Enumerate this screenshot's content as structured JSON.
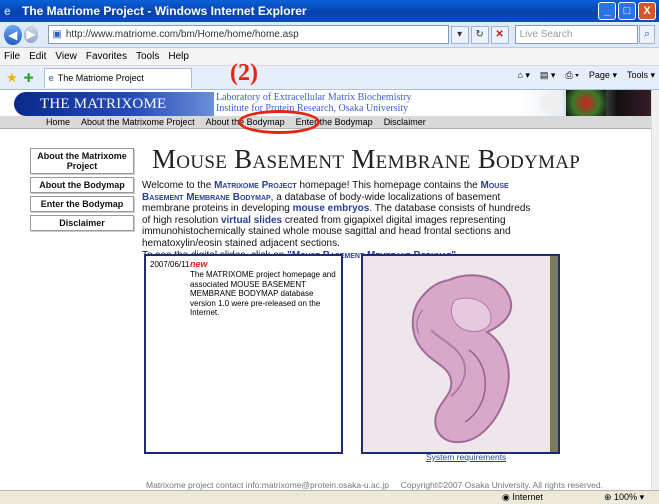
{
  "window": {
    "title": "The Matriome Project - Windows Internet Explorer",
    "buttons": [
      "_",
      "□",
      "X"
    ]
  },
  "address_bar": {
    "url": "http://www.matriome.com/bm/Home/home/home.asp",
    "search_placeholder": "Live Search"
  },
  "menu": [
    "File",
    "Edit",
    "View",
    "Favorites",
    "Tools",
    "Help"
  ],
  "tab": {
    "label": "The Matriome Project",
    "tools": [
      "Page ▾",
      "Tools ▾"
    ]
  },
  "header": {
    "banner": "THE MATRIXOME PROJECT",
    "lab_line1": "Laboratory of Extracellular Matrix Biochemistry",
    "lab_line2": "Institute for Protein Research, Osaka University"
  },
  "topnav": [
    "Home",
    "About the Matrixome Project",
    "About the Bodymap",
    "Enter the Bodymap",
    "Disclaimer"
  ],
  "annotation": {
    "label": "(2)",
    "color": "#e6230f"
  },
  "sidebar": [
    "About the Matrixome Project",
    "About the Bodymap",
    "Enter the Bodymap",
    "Disclaimer"
  ],
  "main": {
    "title": "Mouse Basement Membrane Bodymap",
    "intro": {
      "p1a": "Welcome to the ",
      "brand": "Matrixome Project",
      "p1b": " homepage! This homepage contains the ",
      "bodymap": "Mouse Basement Membrane Bodymap",
      "p1c": ", a database of body-wide localizations of basement membrane proteins in developing ",
      "embryos": "mouse embryos",
      "p1d": ". The database consists of hundreds of high resolution ",
      "slides": "virtual slides",
      "p1e": " created from gigapixel digital images representing immunohistochemically stained whole mouse sagittal and head frontal sections and hematoxylin/eosin stained adjacent sections.",
      "p2a": "To see the digital slides, click on ",
      "link": "\"Mouse Basement Membrane Bodymap\"",
      "p2b": "."
    }
  },
  "news": {
    "date": "2007/06/11",
    "badge": "new",
    "text": "The MATRIXOME project homepage and associated MOUSE BASEMENT MEMBRANE BODYMAP database version 1.0 were pre-released on the Internet."
  },
  "slide": {
    "link": "System requirements"
  },
  "footer": {
    "contact": "Matrixome project contact info:matrixome@protein.osaka-u.ac.jp",
    "copyright": "Copyright©2007 Osaka University. All rights reserved."
  },
  "statusbar": {
    "zone": "Internet",
    "zoom": "100%"
  }
}
